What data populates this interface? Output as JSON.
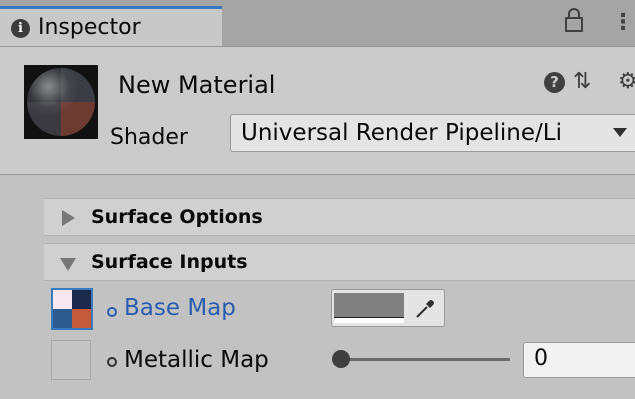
{
  "tab": {
    "label": "Inspector",
    "info_icon": "info-icon"
  },
  "window_controls": {
    "lock_icon": "lock-icon",
    "menu_icon": "kebab-menu-icon"
  },
  "material": {
    "name": "New Material",
    "shader_label": "Shader",
    "shader_value": "Universal Render Pipeline/Li",
    "header_icons": [
      "help-icon",
      "preset-icon",
      "gear-icon"
    ]
  },
  "sections": [
    {
      "label": "Surface Options",
      "expanded": false
    },
    {
      "label": "Surface Inputs",
      "expanded": true
    }
  ],
  "properties": {
    "base_map": {
      "label": "Base Map",
      "color": "#808080"
    },
    "metallic_map": {
      "label": "Metallic Map",
      "value": "0",
      "slider_fraction": 0
    }
  },
  "colors": {
    "accent": "#3a79bb",
    "link": "#2a5db0",
    "panel": "#cbcbcb"
  }
}
